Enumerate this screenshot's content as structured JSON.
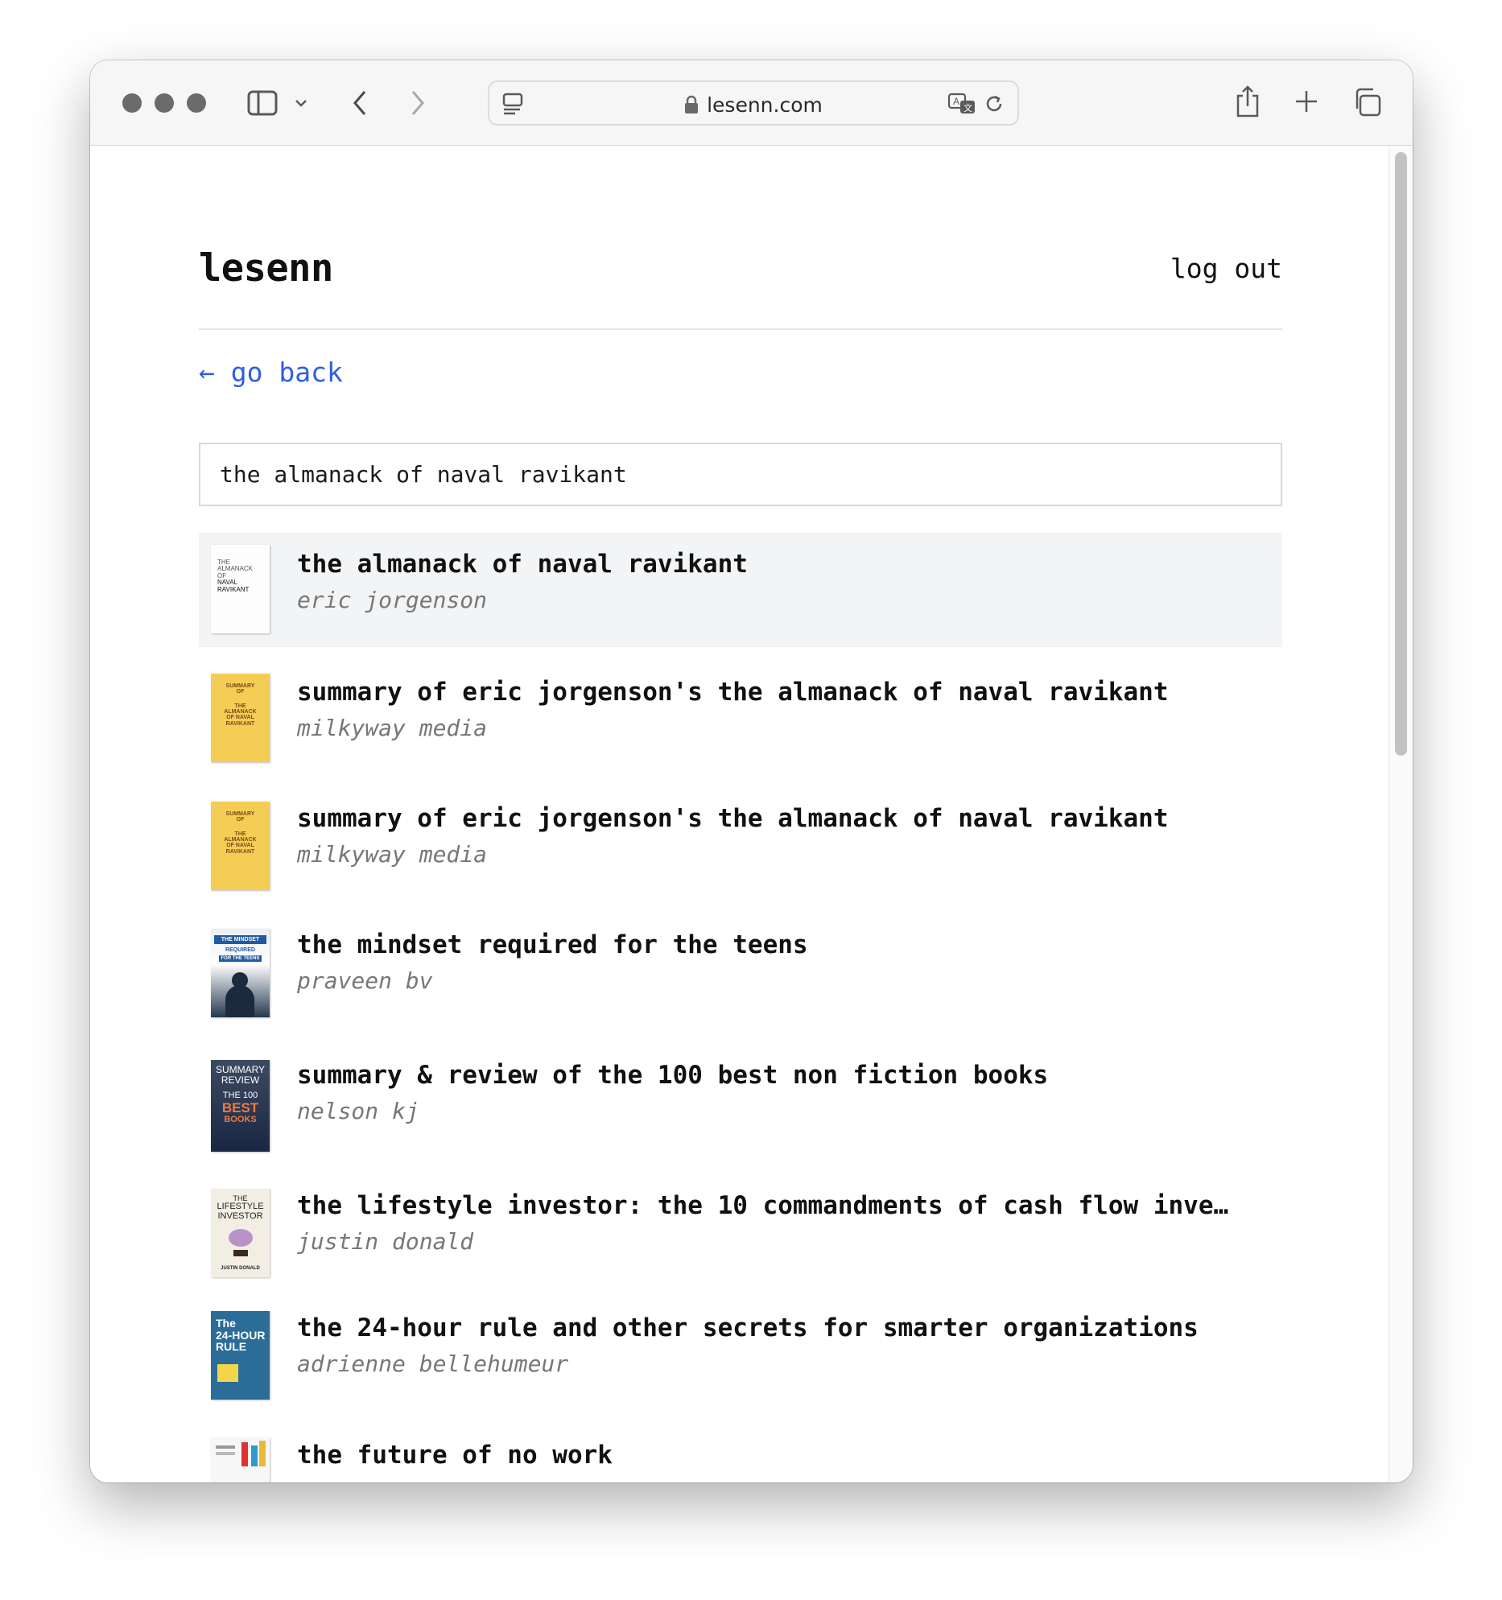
{
  "browser": {
    "url": "lesenn.com",
    "icons": [
      "sidebar-icon",
      "chevron-down-icon",
      "back-arrow-icon",
      "forward-arrow-icon",
      "page-menu-icon",
      "lock-icon",
      "translate-icon",
      "reload-icon",
      "share-icon",
      "new-tab-icon",
      "tabs-overview-icon"
    ]
  },
  "header": {
    "logo": "lesenn",
    "logout": "log out"
  },
  "nav": {
    "go_back": "← go back"
  },
  "search": {
    "query": "the almanack of naval ravikant"
  },
  "results": [
    {
      "title": "the almanack of naval ravikant",
      "author": "eric jorgenson",
      "cover": "almanack",
      "selected": true
    },
    {
      "title": "summary of eric jorgenson's the almanack of naval ravikant",
      "author": "milkyway media",
      "cover": "yellow"
    },
    {
      "title": "summary of eric jorgenson's the almanack of naval ravikant",
      "author": "milkyway media",
      "cover": "yellow"
    },
    {
      "title": "the mindset required for the teens",
      "author": "praveen bv",
      "cover": "mindset"
    },
    {
      "title": "summary & review of the 100 best non fiction books",
      "author": "nelson kj",
      "cover": "summary100"
    },
    {
      "title": "the lifestyle investor: the 10 commandments of cash flow inve…",
      "author": "justin donald",
      "cover": "lifestyle"
    },
    {
      "title": "the 24-hour rule and other secrets for smarter organizations",
      "author": "adrienne bellehumeur",
      "cover": "24hour"
    },
    {
      "title": "the future of no work",
      "author": "",
      "cover": "future"
    }
  ],
  "covers": {
    "almanack": [
      "THE",
      "ALMANACK",
      "OF",
      "NAVAL",
      "RAVIKANT"
    ],
    "yellow": [
      "SUMMARY",
      "OF",
      "THE",
      "ALMANACK",
      "OF NAVAL",
      "RAVIKANT"
    ],
    "mindset": [
      "THE MINDSET",
      "REQUIRED",
      "FOR THE TEENS"
    ],
    "summary100": [
      "SUMMARY",
      "REVIEW",
      "THE 100",
      "BEST",
      "BOOKS"
    ],
    "lifestyle": [
      "THE",
      "LIFESTYLE",
      "INVESTOR",
      "JUSTIN DONALD"
    ],
    "24hour": [
      "The",
      "24-HOUR",
      "RULE"
    ]
  },
  "colors": {
    "link": "#2f5fe0",
    "selected_row": "#f3f4f6",
    "author": "#777777"
  }
}
